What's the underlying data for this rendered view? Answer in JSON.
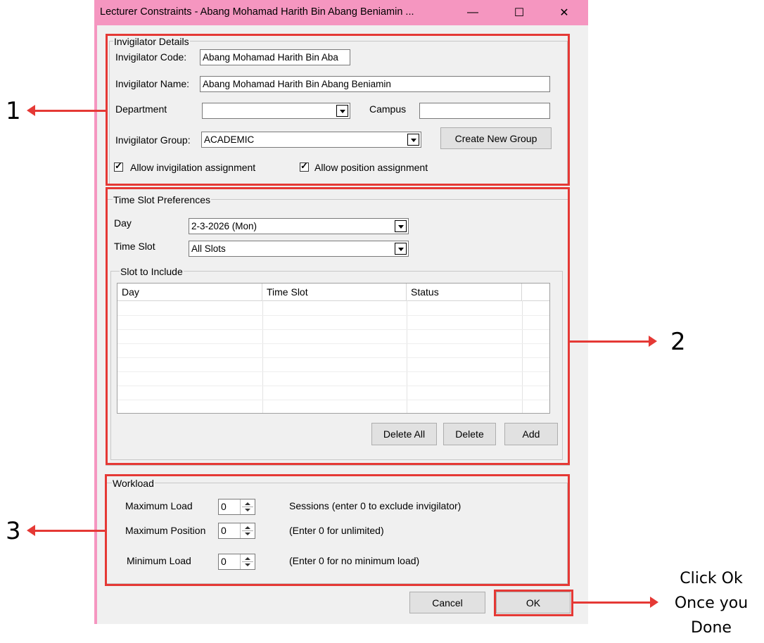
{
  "window": {
    "title": "Lecturer Constraints - Abang Mohamad Harith Bin Abang Beniamin ...",
    "minimize_glyph": "—",
    "maximize_glyph": "☐",
    "close_glyph": "✕"
  },
  "invigilator_details": {
    "group_label": "Invigilator Details",
    "code_label": "Invigilator Code:",
    "code_value": "Abang Mohamad Harith Bin Aba",
    "name_label": "Invigilator Name:",
    "name_value": "Abang Mohamad Harith Bin Abang Beniamin",
    "department_label": "Department",
    "department_value": "",
    "campus_label": "Campus",
    "campus_value": "",
    "group_select_label": "Invigilator Group:",
    "group_select_value": "ACADEMIC",
    "create_group_button": "Create New Group",
    "allow_invigilation_label": "Allow invigilation assignment",
    "allow_invigilation_checked": true,
    "allow_position_label": "Allow position assignment",
    "allow_position_checked": true
  },
  "time_slot_preferences": {
    "group_label": "Time Slot Preferences",
    "day_label": "Day",
    "day_value": "2-3-2026 (Mon)",
    "time_slot_label": "Time Slot",
    "time_slot_value": "All Slots",
    "slot_group_label": "Slot to Include",
    "columns": [
      "Day",
      "Time Slot",
      "Status"
    ],
    "rows": [],
    "delete_all_button": "Delete All",
    "delete_button": "Delete",
    "add_button": "Add"
  },
  "workload": {
    "group_label": "Workload",
    "max_load_label": "Maximum Load",
    "max_load_value": "0",
    "max_load_hint": "Sessions (enter 0 to exclude invigilator)",
    "max_position_label": "Maximum Position",
    "max_position_value": "0",
    "max_position_hint": "(Enter 0 for unlimited)",
    "min_load_label": "Minimum Load",
    "min_load_value": "0",
    "min_load_hint": "(Enter 0 for no minimum load)"
  },
  "footer": {
    "cancel_button": "Cancel",
    "ok_button": "OK"
  },
  "annotations": {
    "callout_1": "1",
    "callout_2": "2",
    "callout_3": "3",
    "ok_note_line1": "Click Ok",
    "ok_note_line2": "Once you",
    "ok_note_line3": "Done",
    "highlight_color": "#e53935"
  },
  "colors": {
    "titlebar": "#f596c0",
    "dialog_bg": "#f0f0f0"
  }
}
